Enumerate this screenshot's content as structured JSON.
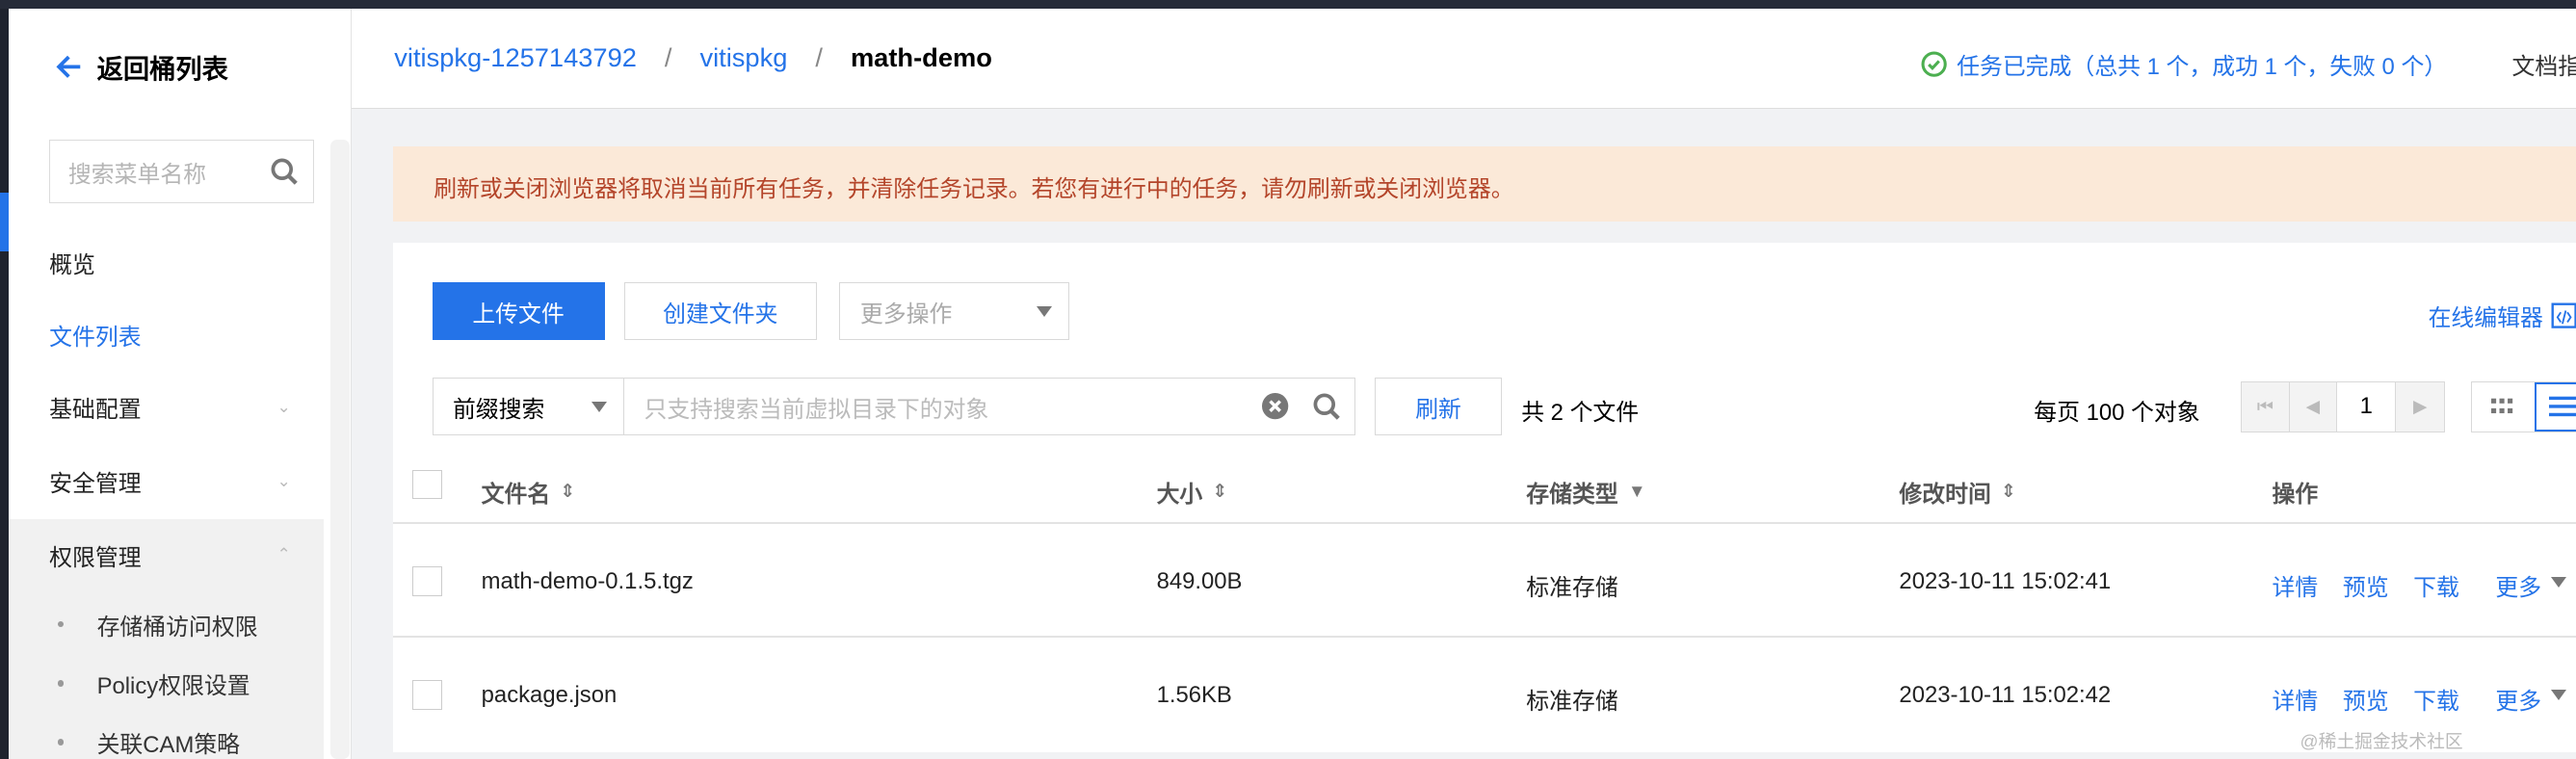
{
  "sidebar": {
    "back_label": "返回桶列表",
    "search_placeholder": "搜索菜单名称",
    "items": [
      {
        "label": "概览"
      },
      {
        "label": "文件列表"
      },
      {
        "label": "基础配置"
      },
      {
        "label": "安全管理"
      },
      {
        "label": "权限管理"
      }
    ],
    "sub_items": [
      {
        "label": "存储桶访问权限"
      },
      {
        "label": "Policy权限设置"
      },
      {
        "label": "关联CAM策略"
      }
    ]
  },
  "header": {
    "breadcrumb": [
      "vitispkg-1257143792",
      "vitispkg",
      "math-demo"
    ],
    "separator": "/",
    "task_status": "任务已完成（总共 1 个，成功 1 个，失败 0 个）",
    "doc_link": "文档指引"
  },
  "banner": {
    "text": "刷新或关闭浏览器将取消当前所有任务，并清除任务记录。若您有进行中的任务，请勿刷新或关闭浏览器。"
  },
  "toolbar": {
    "upload": "上传文件",
    "create_folder": "创建文件夹",
    "more_ops": "更多操作",
    "online_editor": "在线编辑器"
  },
  "search": {
    "mode": "前缀搜索",
    "placeholder": "只支持搜索当前虚拟目录下的对象",
    "refresh": "刷新",
    "total": "共 2 个文件",
    "per_page": "每页 100 个对象",
    "page": "1"
  },
  "table": {
    "columns": [
      "文件名",
      "大小",
      "存储类型",
      "修改时间",
      "操作"
    ],
    "rows": [
      {
        "name": "math-demo-0.1.5.tgz",
        "size": "849.00B",
        "storage": "标准存储",
        "modified": "2023-10-11 15:02:41"
      },
      {
        "name": "package.json",
        "size": "1.56KB",
        "storage": "标准存储",
        "modified": "2023-10-11 15:02:42"
      }
    ],
    "actions": [
      "详情",
      "预览",
      "下载",
      "更多"
    ]
  },
  "watermark": "@稀土掘金技术社区",
  "colors": {
    "accent": "#2473e8",
    "banner_bg": "#fbe9d8",
    "banner_text": "#b4452a",
    "success": "#4caf50"
  }
}
